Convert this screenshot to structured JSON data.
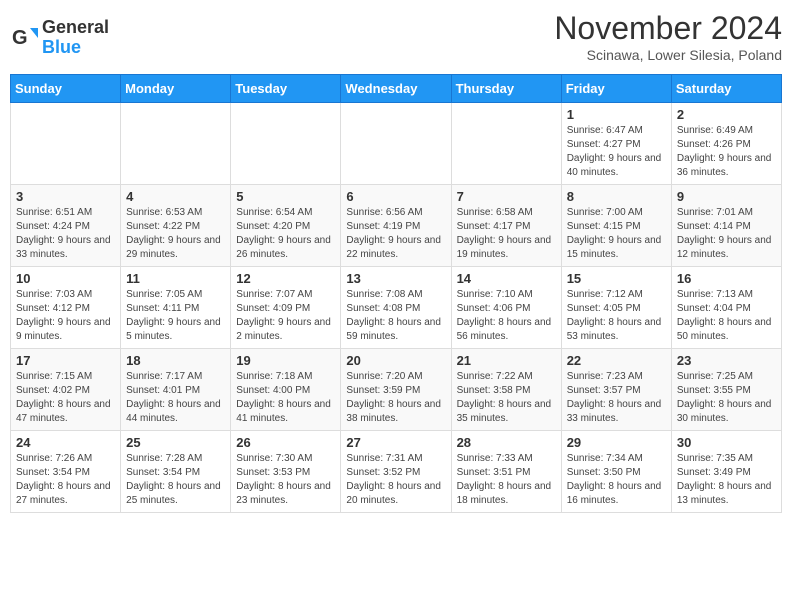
{
  "header": {
    "logo_general": "General",
    "logo_blue": "Blue",
    "title": "November 2024",
    "subtitle": "Scinawa, Lower Silesia, Poland"
  },
  "weekdays": [
    "Sunday",
    "Monday",
    "Tuesday",
    "Wednesday",
    "Thursday",
    "Friday",
    "Saturday"
  ],
  "weeks": [
    [
      {
        "day": "",
        "detail": ""
      },
      {
        "day": "",
        "detail": ""
      },
      {
        "day": "",
        "detail": ""
      },
      {
        "day": "",
        "detail": ""
      },
      {
        "day": "",
        "detail": ""
      },
      {
        "day": "1",
        "detail": "Sunrise: 6:47 AM\nSunset: 4:27 PM\nDaylight: 9 hours\nand 40 minutes."
      },
      {
        "day": "2",
        "detail": "Sunrise: 6:49 AM\nSunset: 4:26 PM\nDaylight: 9 hours\nand 36 minutes."
      }
    ],
    [
      {
        "day": "3",
        "detail": "Sunrise: 6:51 AM\nSunset: 4:24 PM\nDaylight: 9 hours\nand 33 minutes."
      },
      {
        "day": "4",
        "detail": "Sunrise: 6:53 AM\nSunset: 4:22 PM\nDaylight: 9 hours\nand 29 minutes."
      },
      {
        "day": "5",
        "detail": "Sunrise: 6:54 AM\nSunset: 4:20 PM\nDaylight: 9 hours\nand 26 minutes."
      },
      {
        "day": "6",
        "detail": "Sunrise: 6:56 AM\nSunset: 4:19 PM\nDaylight: 9 hours\nand 22 minutes."
      },
      {
        "day": "7",
        "detail": "Sunrise: 6:58 AM\nSunset: 4:17 PM\nDaylight: 9 hours\nand 19 minutes."
      },
      {
        "day": "8",
        "detail": "Sunrise: 7:00 AM\nSunset: 4:15 PM\nDaylight: 9 hours\nand 15 minutes."
      },
      {
        "day": "9",
        "detail": "Sunrise: 7:01 AM\nSunset: 4:14 PM\nDaylight: 9 hours\nand 12 minutes."
      }
    ],
    [
      {
        "day": "10",
        "detail": "Sunrise: 7:03 AM\nSunset: 4:12 PM\nDaylight: 9 hours\nand 9 minutes."
      },
      {
        "day": "11",
        "detail": "Sunrise: 7:05 AM\nSunset: 4:11 PM\nDaylight: 9 hours\nand 5 minutes."
      },
      {
        "day": "12",
        "detail": "Sunrise: 7:07 AM\nSunset: 4:09 PM\nDaylight: 9 hours\nand 2 minutes."
      },
      {
        "day": "13",
        "detail": "Sunrise: 7:08 AM\nSunset: 4:08 PM\nDaylight: 8 hours\nand 59 minutes."
      },
      {
        "day": "14",
        "detail": "Sunrise: 7:10 AM\nSunset: 4:06 PM\nDaylight: 8 hours\nand 56 minutes."
      },
      {
        "day": "15",
        "detail": "Sunrise: 7:12 AM\nSunset: 4:05 PM\nDaylight: 8 hours\nand 53 minutes."
      },
      {
        "day": "16",
        "detail": "Sunrise: 7:13 AM\nSunset: 4:04 PM\nDaylight: 8 hours\nand 50 minutes."
      }
    ],
    [
      {
        "day": "17",
        "detail": "Sunrise: 7:15 AM\nSunset: 4:02 PM\nDaylight: 8 hours\nand 47 minutes."
      },
      {
        "day": "18",
        "detail": "Sunrise: 7:17 AM\nSunset: 4:01 PM\nDaylight: 8 hours\nand 44 minutes."
      },
      {
        "day": "19",
        "detail": "Sunrise: 7:18 AM\nSunset: 4:00 PM\nDaylight: 8 hours\nand 41 minutes."
      },
      {
        "day": "20",
        "detail": "Sunrise: 7:20 AM\nSunset: 3:59 PM\nDaylight: 8 hours\nand 38 minutes."
      },
      {
        "day": "21",
        "detail": "Sunrise: 7:22 AM\nSunset: 3:58 PM\nDaylight: 8 hours\nand 35 minutes."
      },
      {
        "day": "22",
        "detail": "Sunrise: 7:23 AM\nSunset: 3:57 PM\nDaylight: 8 hours\nand 33 minutes."
      },
      {
        "day": "23",
        "detail": "Sunrise: 7:25 AM\nSunset: 3:55 PM\nDaylight: 8 hours\nand 30 minutes."
      }
    ],
    [
      {
        "day": "24",
        "detail": "Sunrise: 7:26 AM\nSunset: 3:54 PM\nDaylight: 8 hours\nand 27 minutes."
      },
      {
        "day": "25",
        "detail": "Sunrise: 7:28 AM\nSunset: 3:54 PM\nDaylight: 8 hours\nand 25 minutes."
      },
      {
        "day": "26",
        "detail": "Sunrise: 7:30 AM\nSunset: 3:53 PM\nDaylight: 8 hours\nand 23 minutes."
      },
      {
        "day": "27",
        "detail": "Sunrise: 7:31 AM\nSunset: 3:52 PM\nDaylight: 8 hours\nand 20 minutes."
      },
      {
        "day": "28",
        "detail": "Sunrise: 7:33 AM\nSunset: 3:51 PM\nDaylight: 8 hours\nand 18 minutes."
      },
      {
        "day": "29",
        "detail": "Sunrise: 7:34 AM\nSunset: 3:50 PM\nDaylight: 8 hours\nand 16 minutes."
      },
      {
        "day": "30",
        "detail": "Sunrise: 7:35 AM\nSunset: 3:49 PM\nDaylight: 8 hours\nand 13 minutes."
      }
    ]
  ]
}
